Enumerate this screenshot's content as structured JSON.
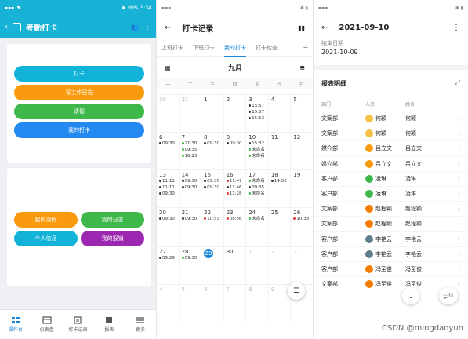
{
  "p1": {
    "status_time": "5:34",
    "status_batt": "99%",
    "title": "考勤打卡",
    "buttons": [
      "打卡",
      "写工作日志",
      "请假",
      "我的打卡"
    ],
    "grid": [
      "我的请假",
      "我的日志",
      "个人信息",
      "我的报销"
    ],
    "tabs": [
      "操作台",
      "仪表盘",
      "打卡记录",
      "报表",
      "更多"
    ],
    "colors": {
      "header": "#17b2d6",
      "cyan": "#12b3d9",
      "orange": "#fa9a0e",
      "green": "#3eb84a",
      "blue": "#2388f0",
      "purple": "#9c27b0"
    }
  },
  "p2": {
    "title": "打卡记录",
    "tabs": [
      "上班打卡",
      "下班打卡",
      "我的打卡",
      "打卡检查"
    ],
    "month": "九月",
    "weekdays": [
      "一",
      "二",
      "三",
      "四",
      "五",
      "六",
      "日"
    ],
    "rows": [
      [
        {
          "d": "30",
          "dim": true,
          "r": []
        },
        {
          "d": "31",
          "dim": true,
          "r": []
        },
        {
          "d": "1",
          "r": []
        },
        {
          "d": "2",
          "r": []
        },
        {
          "d": "3",
          "r": [
            [
              "15:57",
              "#333"
            ],
            [
              "15:57",
              "#333"
            ],
            [
              "15:53",
              "#333"
            ]
          ]
        },
        {
          "d": "4",
          "r": []
        },
        {
          "d": "5",
          "r": []
        }
      ],
      [
        {
          "d": "6",
          "r": [
            [
              "09:30",
              "#333"
            ]
          ]
        },
        {
          "d": "7",
          "r": [
            [
              "21:30",
              "#3eb84a"
            ],
            [
              "09:35",
              "#3eb84a"
            ],
            [
              "16:23",
              "#3eb84a"
            ]
          ]
        },
        {
          "d": "8",
          "r": [
            [
              "09:30",
              "#333"
            ]
          ]
        },
        {
          "d": "9",
          "r": [
            [
              "09:30",
              "#333"
            ]
          ]
        },
        {
          "d": "10",
          "r": [
            [
              "15:32",
              "#333"
            ],
            [
              "未命名",
              "#3eb84a"
            ],
            [
              "未命名",
              "#3eb84a"
            ]
          ]
        },
        {
          "d": "11",
          "r": []
        },
        {
          "d": "12",
          "r": []
        }
      ],
      [
        {
          "d": "13",
          "r": [
            [
              "11:11",
              "#333"
            ],
            [
              "11:11",
              "#333"
            ],
            [
              "09:30",
              "#333"
            ]
          ]
        },
        {
          "d": "14",
          "r": [
            [
              "09:30",
              "#333"
            ],
            [
              "09:30",
              "#333"
            ]
          ]
        },
        {
          "d": "15",
          "r": [
            [
              "09:30",
              "#333"
            ],
            [
              "09:30",
              "#333"
            ]
          ]
        },
        {
          "d": "16",
          "r": [
            [
              "11:47",
              "#e53935"
            ],
            [
              "11:46",
              "#333"
            ],
            [
              "11:28",
              "#e53935"
            ]
          ]
        },
        {
          "d": "17",
          "r": [
            [
              "未命名",
              "#3eb84a"
            ],
            [
              "09:35",
              "#333"
            ],
            [
              "未命名",
              "#3eb84a"
            ]
          ]
        },
        {
          "d": "18",
          "r": [
            [
              "14:52",
              "#333"
            ]
          ]
        },
        {
          "d": "19",
          "r": []
        }
      ],
      [
        {
          "d": "20",
          "r": [
            [
              "09:30",
              "#333"
            ]
          ]
        },
        {
          "d": "21",
          "r": [
            [
              "09:30",
              "#333"
            ]
          ]
        },
        {
          "d": "22",
          "r": [
            [
              "10:53",
              "#e53935"
            ]
          ]
        },
        {
          "d": "23",
          "r": [
            [
              "08:56",
              "#e53935"
            ]
          ]
        },
        {
          "d": "24",
          "r": [
            [
              "未命名",
              "#3eb84a"
            ]
          ]
        },
        {
          "d": "25",
          "r": []
        },
        {
          "d": "26",
          "r": [
            [
              "10:33",
              "#e53935"
            ]
          ]
        }
      ],
      [
        {
          "d": "27",
          "r": [
            [
              "09:29",
              "#333"
            ]
          ]
        },
        {
          "d": "28",
          "r": [
            [
              "09:30",
              "#3eb84a"
            ]
          ]
        },
        {
          "d": "29",
          "today": true,
          "r": []
        },
        {
          "d": "30",
          "r": []
        },
        {
          "d": "1",
          "dim": true,
          "r": []
        },
        {
          "d": "2",
          "dim": true,
          "r": []
        },
        {
          "d": "3",
          "dim": true,
          "r": []
        }
      ],
      [
        {
          "d": "4",
          "dim": true,
          "r": []
        },
        {
          "d": "5",
          "dim": true,
          "r": []
        },
        {
          "d": "6",
          "dim": true,
          "r": []
        },
        {
          "d": "7",
          "dim": true,
          "r": []
        },
        {
          "d": "8",
          "dim": true,
          "r": []
        },
        {
          "d": "9",
          "dim": true,
          "r": []
        },
        {
          "d": "10",
          "dim": true,
          "r": []
        }
      ]
    ]
  },
  "p3": {
    "title": "2021-09-10",
    "end_label": "结束日期",
    "end_value": "2021-10-09",
    "section": "报表明细",
    "cols": [
      "部门",
      "人员",
      "姓名"
    ],
    "rows": [
      [
        "文案部",
        "何颖",
        "何颖",
        "#f5c242"
      ],
      [
        "文案部",
        "何颖",
        "何颖",
        "#f5c242"
      ],
      [
        "媒介部",
        "吕立文",
        "吕立文",
        "#fa9a0e"
      ],
      [
        "媒介部",
        "吕立文",
        "吕立文",
        "#fa9a0e"
      ],
      [
        "客户部",
        "凌琳",
        "凌琳",
        "#3eb84a"
      ],
      [
        "客户部",
        "凌琳",
        "凌琳",
        "#3eb84a"
      ],
      [
        "文案部",
        "赵程颖",
        "赵程颖",
        "#f57c00"
      ],
      [
        "文案部",
        "赵程颖",
        "赵程颖",
        "#f57c00"
      ],
      [
        "客户部",
        "李艳云",
        "李艳云",
        "#607d8b"
      ],
      [
        "客户部",
        "李艳云",
        "李艳云",
        "#607d8b"
      ],
      [
        "客户部",
        "冯至俊",
        "冯至俊",
        "#f57c00"
      ],
      [
        "文案部",
        "冯至俊",
        "冯至俊",
        "#f57c00"
      ]
    ],
    "comment_count": "0",
    "watermark": "CSDN @mingdaoyun"
  }
}
